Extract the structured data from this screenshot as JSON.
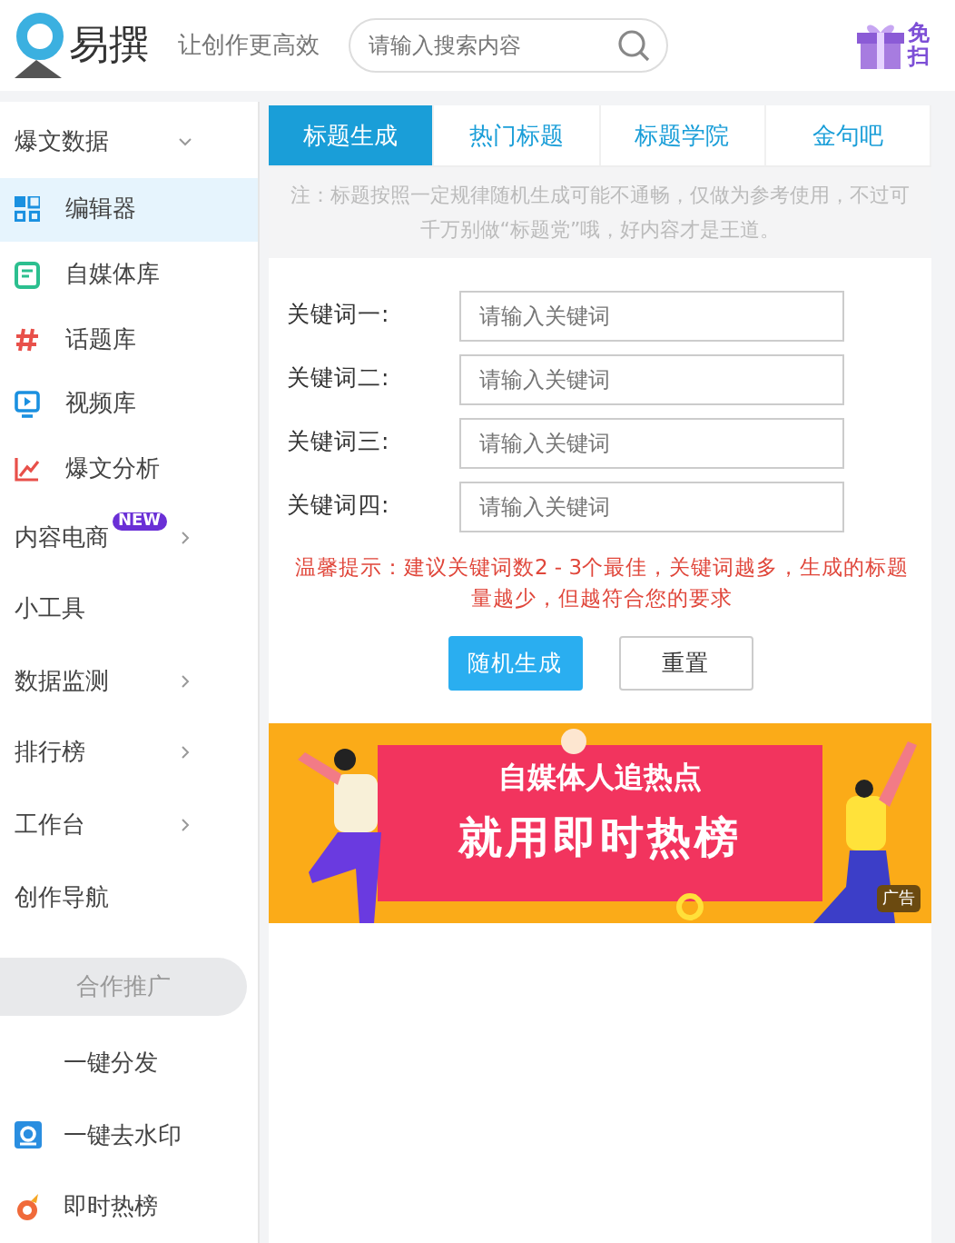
{
  "header": {
    "brand": "易撰",
    "slogan": "让创作更高效",
    "search": {
      "placeholder": "请输入搜索内容"
    },
    "promo": [
      "免",
      "扫"
    ]
  },
  "sidebar": {
    "items": [
      {
        "label": "爆文数据",
        "kind": "group",
        "expanded": true,
        "children": [
          {
            "label": "编辑器",
            "selected": true
          },
          {
            "label": "自媒体库",
            "selected": false
          },
          {
            "label": "话题库",
            "selected": false
          },
          {
            "label": "视频库",
            "selected": false
          },
          {
            "label": "爆文分析",
            "selected": false
          }
        ]
      },
      {
        "label": "内容电商",
        "kind": "group",
        "expanded": false,
        "badge": "NEW"
      },
      {
        "label": "小工具",
        "kind": "plain"
      },
      {
        "label": "数据监测",
        "kind": "group",
        "expanded": false
      },
      {
        "label": "排行榜",
        "kind": "group",
        "expanded": false
      },
      {
        "label": "工作台",
        "kind": "group",
        "expanded": false
      },
      {
        "label": "创作导航",
        "kind": "plain"
      },
      {
        "label": "合作推广",
        "kind": "section"
      },
      {
        "label": "一键分发",
        "kind": "link"
      },
      {
        "label": "一键去水印",
        "kind": "link"
      },
      {
        "label": "即时热榜",
        "kind": "link"
      }
    ]
  },
  "tabs": [
    {
      "label": "标题生成",
      "selected": true
    },
    {
      "label": "热门标题",
      "selected": false
    },
    {
      "label": "标题学院",
      "selected": false
    },
    {
      "label": "金句吧",
      "selected": false
    }
  ],
  "note": "注：标题按照一定规律随机生成可能不通畅，仅做为参考使用，不过可千万别做“标题党”哦，好内容才是王道。",
  "form": {
    "fields": [
      {
        "label": "关键词一:",
        "placeholder": "请输入关键词"
      },
      {
        "label": "关键词二:",
        "placeholder": "请输入关键词"
      },
      {
        "label": "关键词三:",
        "placeholder": "请输入关键词"
      },
      {
        "label": "关键词四:",
        "placeholder": "请输入关键词"
      }
    ],
    "hint": "温馨提示：建议关键词数2 - 3个最佳，关键词越多，生成的标题量越少，但越符合您的要求",
    "buttons": [
      {
        "label": "随机生成",
        "kind": "primary"
      },
      {
        "label": "重置",
        "kind": "secondary"
      }
    ]
  },
  "banner": {
    "line_1": "自媒体人追热点",
    "line_2": "就用即时热榜",
    "ad_label": "广告"
  }
}
